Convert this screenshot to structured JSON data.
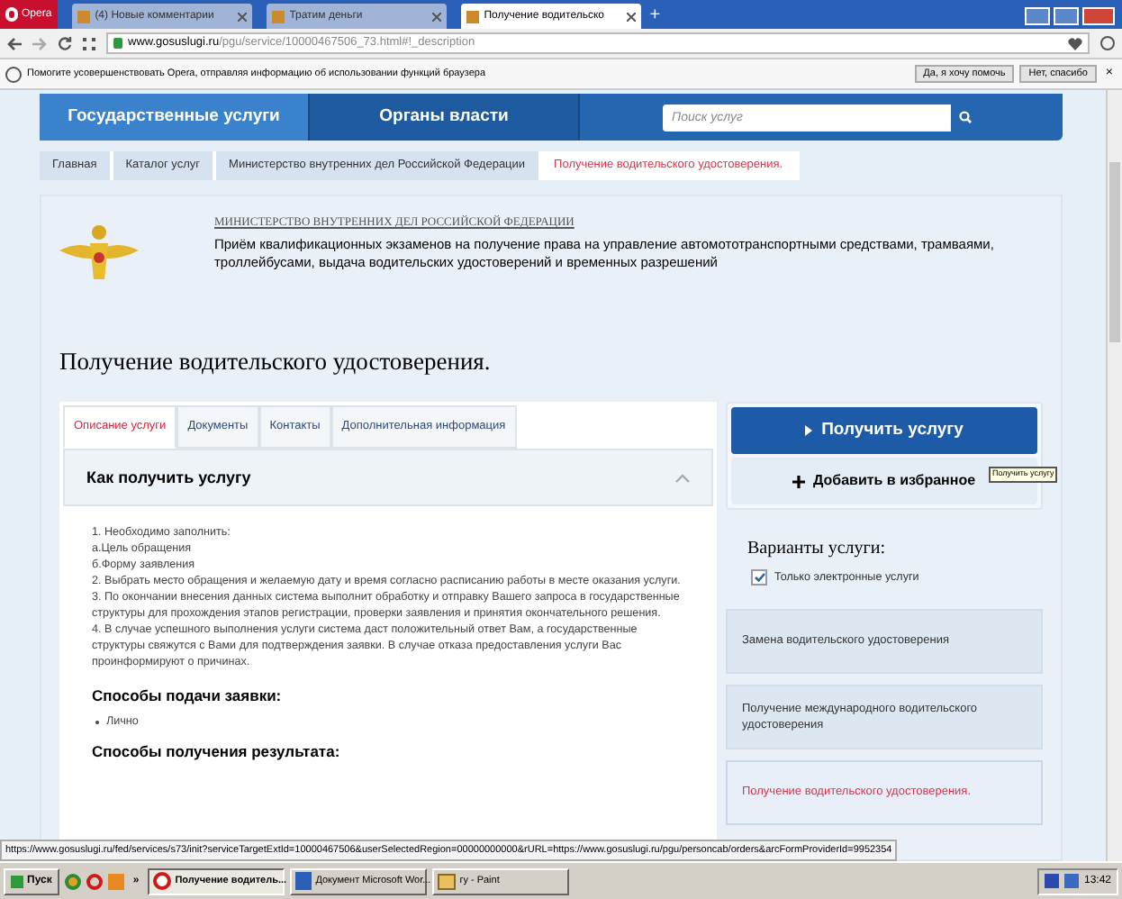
{
  "browser": {
    "menu_label": "Opera",
    "tabs": [
      {
        "label": "(4) Новые комментарии",
        "selected": false
      },
      {
        "label": "Тратим деньги",
        "selected": false
      },
      {
        "label": "Получение водительско",
        "selected": true
      }
    ],
    "new_tab": "+",
    "url_host": "www.gosuslugi.ru",
    "url_path": "/pgu/service/10000467506_73.html#!_description",
    "infobar": {
      "text": "Помогите усовершенствовать Opera, отправляя информацию об использовании функций браузера",
      "buttons": [
        "Да, я хочу помочь",
        "Нет, спасибо"
      ],
      "close": "×"
    }
  },
  "nav": {
    "items": [
      {
        "label": "Государственные услуги",
        "selected": true
      },
      {
        "label": "Органы власти",
        "selected": false
      }
    ],
    "search": {
      "placeholder": "Поиск услуг"
    }
  },
  "breadcrumbs": [
    {
      "label": "Главная",
      "current": false
    },
    {
      "label": "Каталог услуг",
      "current": false
    },
    {
      "label": "Министерство внутренних дел Российской Федерации",
      "current": false
    },
    {
      "label": "Получение водительского удостоверения.",
      "current": true
    }
  ],
  "agency": {
    "name": "МИНИСТЕРСТВО ВНУТРЕННИХ ДЕЛ РОССИЙСКОЙ ФЕДЕРАЦИИ",
    "service": "Приём квалификационных экзаменов на получение права на управление автомототранспортными средствами, трамваями, троллейбусами, выдача водительских удостоверений и временных разрешений"
  },
  "title": "Получение водительского удостоверения.",
  "content_tabs": [
    {
      "label": "Описание услуги",
      "selected": true
    },
    {
      "label": "Документы",
      "selected": false
    },
    {
      "label": "Контакты",
      "selected": false
    },
    {
      "label": "Дополнительная информация",
      "selected": false
    }
  ],
  "section": {
    "title": "Как получить услугу",
    "expanded": true,
    "paragraphs": [
      "1. Необходимо заполнить:",
      "а.Цель обращения",
      "б.Форму заявления",
      "2. Выбрать место обращения и желаемую дату и время согласно расписанию работы в месте оказания услуги.",
      "3. По окончании внесения данных система выполнит обработку и отправку Вашего запроса в государственные структуры для прохождения этапов регистрации, проверки заявления и принятия окончательного решения.",
      "4. В случае успешного выполнения услуги система даст положительный ответ Вам, а государственные структуры свяжутся с Вами для подтверждения заявки. В случае отказа предоставления услуги Вас проинформируют о причинах."
    ],
    "submit_heading": "Способы подачи заявки:",
    "submit_methods": [
      "Лично"
    ],
    "result_heading": "Способы получения результата:"
  },
  "actions": {
    "primary": "Получить услугу",
    "secondary": "Добавить в избранное",
    "tooltip": "Получить услугу"
  },
  "variants": {
    "title": "Варианты услуги:",
    "filter": {
      "label": "Только электронные услуги",
      "checked": true
    },
    "items": [
      {
        "label": "Замена водительского удостоверения",
        "selected": false
      },
      {
        "label": "Получение международного водительского удостоверения",
        "selected": false
      },
      {
        "label": "Получение водительского удостоверения.",
        "selected": true
      }
    ]
  },
  "status_url": "https://www.gosuslugi.ru/fed/services/s73/init?serviceTargetExtId=10000467506&userSelectedRegion=00000000000&rURL=https://www.gosuslugi.ru/pgu/personcab/orders&arcFormProviderId=9952354",
  "taskbar": {
    "start": "Пуск",
    "overflow": "»",
    "tasks": [
      {
        "label": "Получение водитель...",
        "selected": true,
        "kind": "browser"
      },
      {
        "label": "Документ Microsoft Wor...",
        "selected": false,
        "kind": "document"
      },
      {
        "label": "гу - Paint",
        "selected": false,
        "kind": "paint"
      }
    ],
    "clock": "13:42"
  }
}
